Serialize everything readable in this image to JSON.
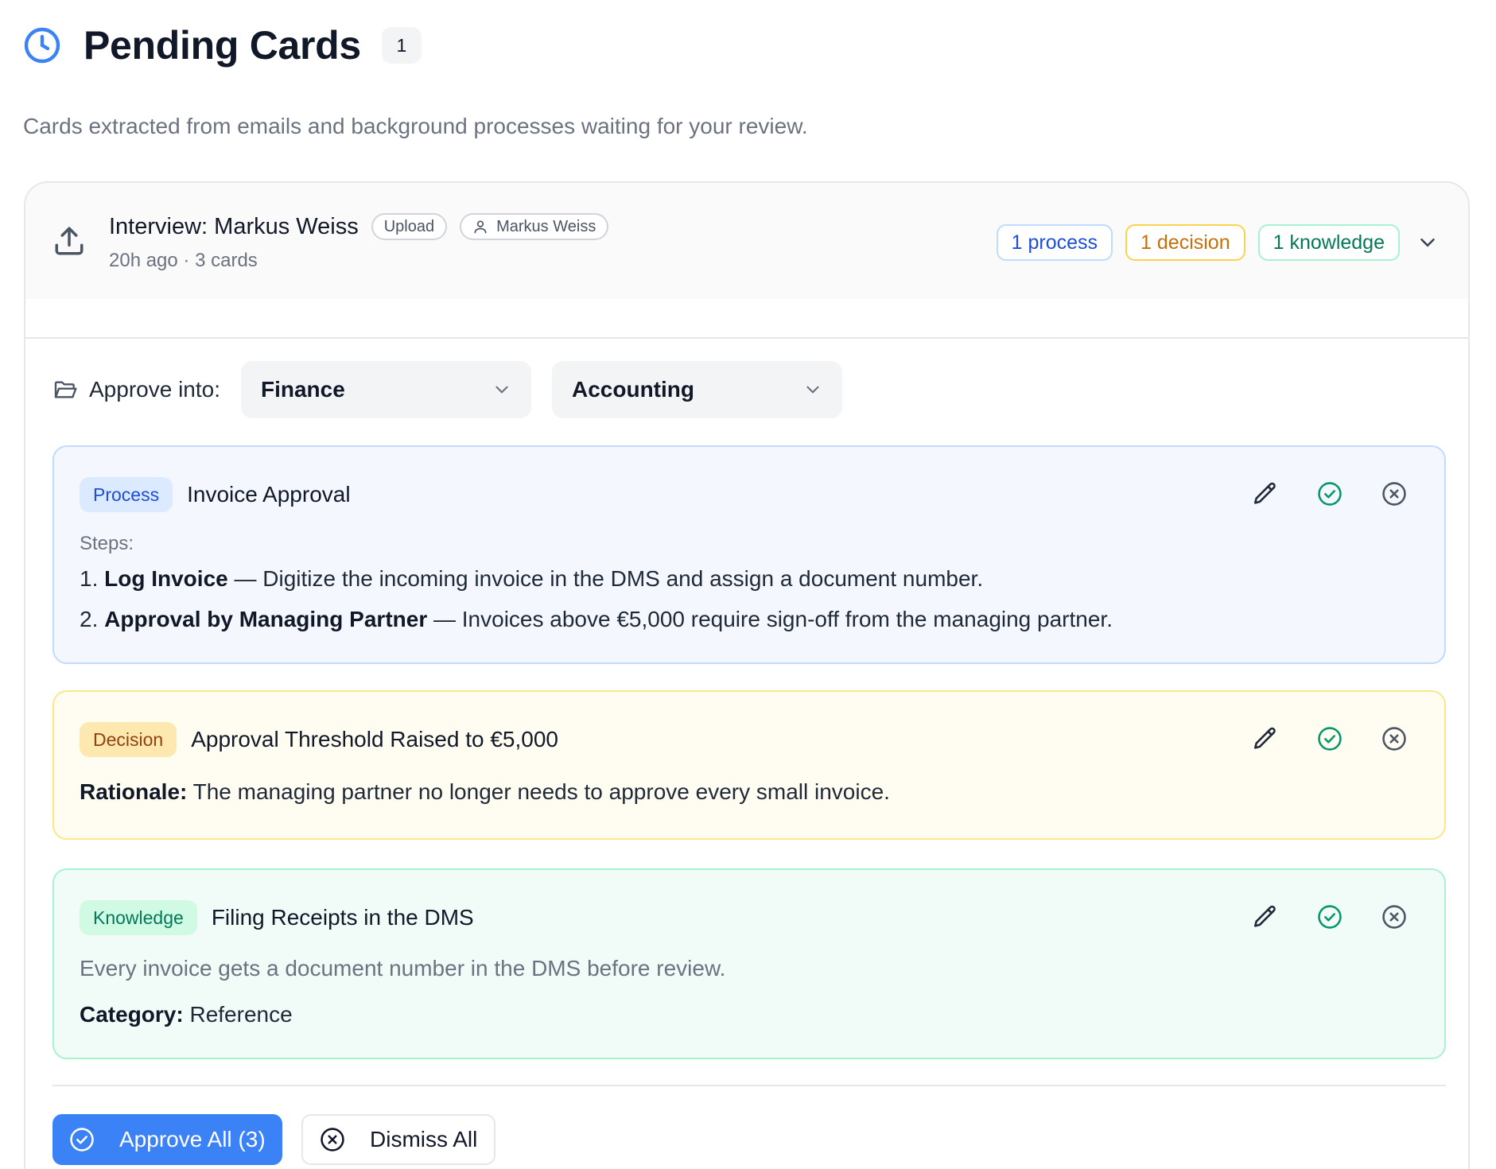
{
  "header": {
    "title": "Pending Cards",
    "count": "1",
    "subtitle": "Cards extracted from emails and background processes waiting for your review.",
    "icon": "clock-icon"
  },
  "group": {
    "title": "Interview: Markus Weiss",
    "source_pill": "Upload",
    "author_pill": "Markus Weiss",
    "meta": "20h ago · 3 cards",
    "type_counts": {
      "process": "1 process",
      "decision": "1 decision",
      "knowledge": "1 knowledge"
    }
  },
  "approve_into": {
    "label": "Approve into:",
    "department": "Finance",
    "team": "Accounting"
  },
  "cards": {
    "process": {
      "type_label": "Process",
      "title": "Invoice Approval",
      "steps_label": "Steps:",
      "steps": [
        {
          "num": "1.",
          "name": "Log Invoice",
          "desc": " — Digitize the incoming invoice in the DMS and assign a document number."
        },
        {
          "num": "2.",
          "name": "Approval by Managing Partner",
          "desc": " — Invoices above €5,000 require sign-off from the managing partner."
        }
      ]
    },
    "decision": {
      "type_label": "Decision",
      "title": "Approval Threshold Raised to €5,000",
      "rationale_label": "Rationale:",
      "rationale": " The managing partner no longer needs to approve every small invoice."
    },
    "knowledge": {
      "type_label": "Knowledge",
      "title": "Filing Receipts in the DMS",
      "body": "Every invoice gets a document number in the DMS before review.",
      "category_label": "Category:",
      "category": " Reference"
    }
  },
  "footer": {
    "approve_all": "Approve All (3)",
    "dismiss_all": "Dismiss All"
  },
  "colors": {
    "accent": "#3b82f6",
    "process": "#1d4ed8",
    "decision": "#c2710c",
    "knowledge": "#047857",
    "approve_check": "#059669"
  }
}
